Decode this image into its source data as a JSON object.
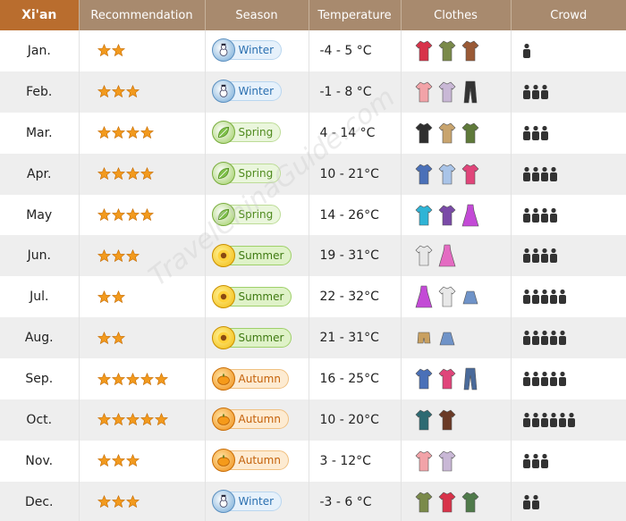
{
  "header": {
    "city": "Xi'an",
    "col_recommendation": "Recommendation",
    "col_season": "Season",
    "col_temperature": "Temperature",
    "col_clothes": "Clothes",
    "col_crowd": "Crowd"
  },
  "watermark": "TravelChinaGuide.com",
  "rows": [
    {
      "month": "Jan.",
      "stars": 2,
      "season": "Winter",
      "season_icon": "snowman-icon",
      "temperature": "-4 - 5 °C",
      "clothes": [
        "red-winter-coat-icon",
        "green-parka-icon",
        "brown-coat-icon"
      ],
      "crowd": 1
    },
    {
      "month": "Feb.",
      "stars": 3,
      "season": "Winter",
      "season_icon": "snowman-icon",
      "temperature": "-1 - 8 °C",
      "clothes": [
        "pink-coat-icon",
        "plaid-shirt-icon",
        "black-trousers-icon"
      ],
      "crowd": 3
    },
    {
      "month": "Mar.",
      "stars": 4,
      "season": "Spring",
      "season_icon": "leaf-icon",
      "temperature": "4 - 14 °C",
      "clothes": [
        "black-jacket-icon",
        "beige-trench-coat-icon",
        "green-jacket-icon"
      ],
      "crowd": 3
    },
    {
      "month": "Apr.",
      "stars": 4,
      "season": "Spring",
      "season_icon": "leaf-icon",
      "temperature": "10 - 21°C",
      "clothes": [
        "raglan-shirt-icon",
        "blue-shirt-icon",
        "pink-hoodie-icon"
      ],
      "crowd": 4
    },
    {
      "month": "May",
      "stars": 4,
      "season": "Spring",
      "season_icon": "leaf-icon",
      "temperature": "14 - 26°C",
      "clothes": [
        "cyan-tshirt-icon",
        "purple-top-icon",
        "purple-dress-icon"
      ],
      "crowd": 4
    },
    {
      "month": "Jun.",
      "stars": 3,
      "season": "Summer",
      "season_icon": "sunflower-icon",
      "temperature": "19 - 31°C",
      "clothes": [
        "white-shirt-icon",
        "pink-dress-icon"
      ],
      "crowd": 4
    },
    {
      "month": "Jul.",
      "stars": 2,
      "season": "Summer",
      "season_icon": "sunflower-icon",
      "temperature": "22 - 32°C",
      "clothes": [
        "purple-dress-icon",
        "white-shirt-icon",
        "denim-skirt-icon"
      ],
      "crowd": 5
    },
    {
      "month": "Aug.",
      "stars": 2,
      "season": "Summer",
      "season_icon": "sunflower-icon",
      "temperature": "21 - 31°C",
      "clothes": [
        "khaki-shorts-icon",
        "denim-skirt-icon"
      ],
      "crowd": 5
    },
    {
      "month": "Sep.",
      "stars": 5,
      "season": "Autumn",
      "season_icon": "pumpkin-icon",
      "temperature": "16 - 25°C",
      "clothes": [
        "raglan-shirt-icon",
        "pink-hoodie-icon",
        "jeans-icon"
      ],
      "crowd": 5
    },
    {
      "month": "Oct.",
      "stars": 5,
      "season": "Autumn",
      "season_icon": "pumpkin-icon",
      "temperature": "10 - 20°C",
      "clothes": [
        "teal-sweater-icon",
        "brown-jacket-icon"
      ],
      "crowd": 6
    },
    {
      "month": "Nov.",
      "stars": 3,
      "season": "Autumn",
      "season_icon": "pumpkin-icon",
      "temperature": "3 - 12°C",
      "clothes": [
        "pink-coat-icon",
        "plaid-shirt-icon"
      ],
      "crowd": 3
    },
    {
      "month": "Dec.",
      "stars": 3,
      "season": "Winter",
      "season_icon": "snowman-icon",
      "temperature": "-3 - 6 °C",
      "clothes": [
        "green-parka-icon",
        "red-winter-coat-icon",
        "green-coat-icon"
      ],
      "crowd": 2
    }
  ],
  "colors": {
    "header_bg": "#a88a6e",
    "header_first_bg": "#b96d2e",
    "star": "#f29a1e",
    "crowd_icon": "#333333"
  }
}
